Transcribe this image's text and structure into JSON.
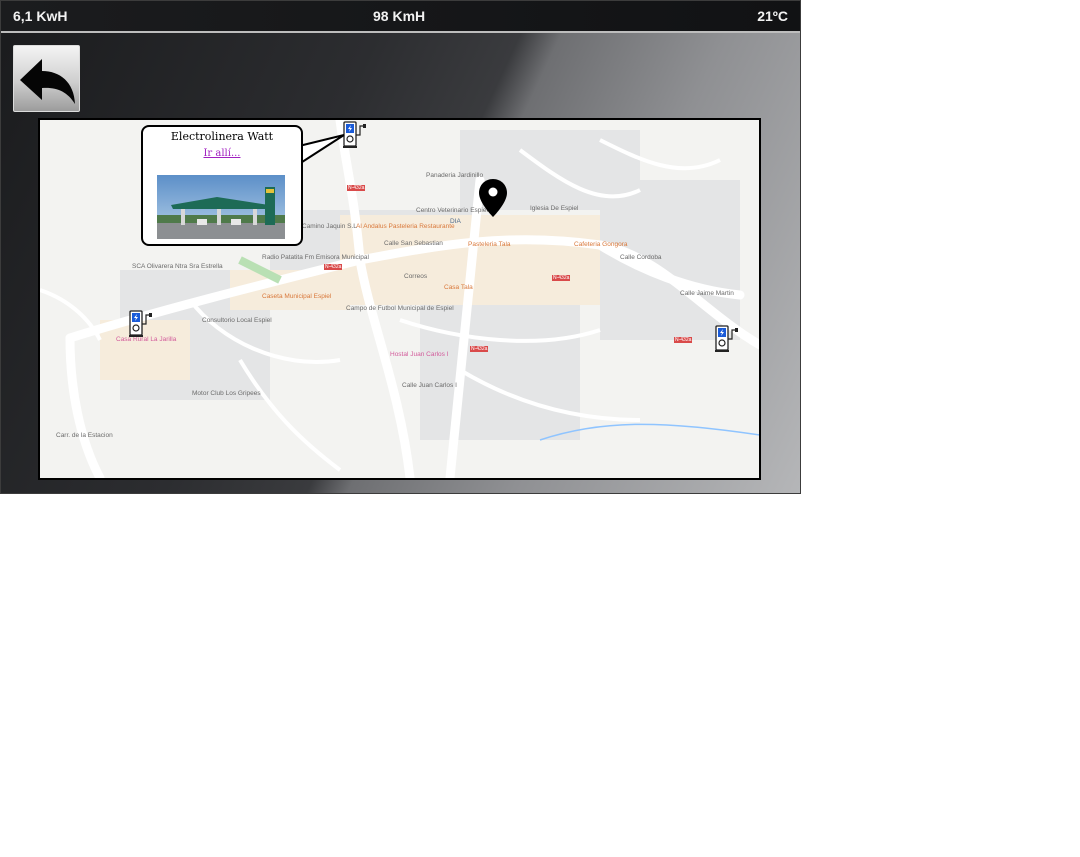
{
  "status": {
    "energy": "6,1 KwH",
    "speed": "98 KmH",
    "temperature": "21ºC"
  },
  "popup": {
    "title": "Electrolinera Watt",
    "link": "Ir allí..."
  },
  "map_labels": {
    "l1": "Centro Veterinario Espiel",
    "l2": "DIA",
    "l3": "Iglesia De Espiel",
    "l4": "Al Andalus Pasteleria Restaurante",
    "l5": "Pasteleria Tala",
    "l6": "Cafeteria Gongora",
    "l7": "Radio Patatita Fm Emisora Municipal",
    "l8": "Correos",
    "l9": "Casa Tala",
    "l10": "Caseta Municipal Espiel",
    "l11": "Campo de Futbol Municipal de Espiel",
    "l12": "SCA Olivarera Ntra Sra Estrella",
    "l13": "Consultorio Local Espiel",
    "l14": "Casa Rural La Jarilla",
    "l15": "Hostal Juan Carlos I",
    "l16": "Motor Club Los Gripees",
    "l17": "Panaderia Jardinillo",
    "l18": "Camino Jaquin S.L",
    "l19": "Calle Cordoba",
    "l20": "Calle Juan Carlos I",
    "l21": "Carr. de la Estacion",
    "l22": "Calle San Sebastian",
    "l23": "Calle Jaime Martin"
  },
  "colors": {
    "popup_link": "#a020c0",
    "charger": "#1a5bd8",
    "pin": "#000000"
  }
}
